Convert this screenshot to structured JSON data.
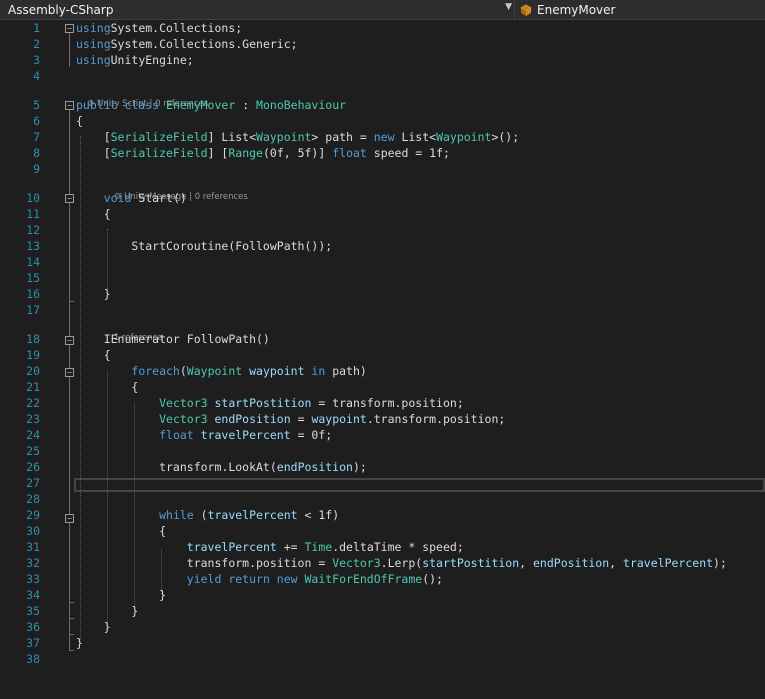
{
  "navbar": {
    "project": "Assembly-CSharp",
    "member": "EnemyMover",
    "member_icon": "class-member-icon"
  },
  "codelens": {
    "class_lens": "Unity Script | 0 references",
    "start_lens": "Unity Message | 0 references",
    "followpath_lens": "1 reference"
  },
  "line_numbers": [
    "1",
    "2",
    "3",
    "4",
    "5",
    "6",
    "7",
    "8",
    "9",
    "10",
    "11",
    "12",
    "13",
    "14",
    "15",
    "16",
    "17",
    "18",
    "19",
    "20",
    "21",
    "22",
    "23",
    "24",
    "25",
    "26",
    "27",
    "28",
    "29",
    "30",
    "31",
    "32",
    "33",
    "34",
    "35",
    "36",
    "37",
    "38"
  ],
  "lines": [
    [
      [
        "kw",
        "using"
      ],
      [
        "",
        "System.Collections;"
      ]
    ],
    [
      [
        "kw",
        "using"
      ],
      [
        "",
        "System.Collections.Generic;"
      ]
    ],
    [
      [
        "kw",
        "using"
      ],
      [
        "",
        "UnityEngine;"
      ]
    ],
    [],
    [
      [
        "kw",
        "public class "
      ],
      [
        "ty",
        "EnemyMover"
      ],
      [
        "",
        " : "
      ],
      [
        "ty",
        "MonoBehaviour"
      ]
    ],
    [
      [
        "",
        "{"
      ]
    ],
    [
      [
        "",
        "    ["
      ],
      [
        "ty",
        "SerializeField"
      ],
      [
        "",
        "] List<"
      ],
      [
        "ty",
        "Waypoint"
      ],
      [
        "",
        "> path = "
      ],
      [
        "kw",
        "new "
      ],
      [
        "",
        "List<"
      ],
      [
        "ty",
        "Waypoint"
      ],
      [
        "",
        ">();"
      ]
    ],
    [
      [
        "",
        "    ["
      ],
      [
        "ty",
        "SerializeField"
      ],
      [
        "",
        "] ["
      ],
      [
        "ty",
        "Range"
      ],
      [
        "",
        "(0f, 5f)] "
      ],
      [
        "kw",
        "float"
      ],
      [
        "",
        " speed = 1f;"
      ]
    ],
    [],
    [
      [
        "",
        "    "
      ],
      [
        "kw",
        "void "
      ],
      [
        "",
        "Start()"
      ]
    ],
    [
      [
        "",
        "    {"
      ]
    ],
    [],
    [
      [
        "",
        "        StartCoroutine(FollowPath());"
      ]
    ],
    [],
    [],
    [
      [
        "",
        "    }"
      ]
    ],
    [],
    [
      [
        "",
        "    IEnumerator FollowPath()"
      ]
    ],
    [
      [
        "",
        "    {"
      ]
    ],
    [
      [
        "",
        "        "
      ],
      [
        "kw",
        "foreach"
      ],
      [
        "",
        "("
      ],
      [
        "ty",
        "Waypoint"
      ],
      [
        " pm",
        " waypoint"
      ],
      [
        " kw",
        " in"
      ],
      [
        "",
        " path)"
      ]
    ],
    [
      [
        "",
        "        {"
      ]
    ],
    [
      [
        "",
        "            "
      ],
      [
        "ty",
        "Vector3"
      ],
      [
        "pm",
        " startPostition"
      ],
      [
        "",
        " = transform.position;"
      ]
    ],
    [
      [
        "",
        "            "
      ],
      [
        "ty",
        "Vector3"
      ],
      [
        "pm",
        " endPosition"
      ],
      [
        "",
        " = "
      ],
      [
        "pm",
        "waypoint"
      ],
      [
        "",
        ".transform.position;"
      ]
    ],
    [
      [
        "",
        "            "
      ],
      [
        "kw",
        "float"
      ],
      [
        "pm",
        " travelPercent"
      ],
      [
        "",
        " = 0f;"
      ]
    ],
    [],
    [
      [
        "",
        "            transform.LookAt("
      ],
      [
        "pm",
        "endPosition"
      ],
      [
        "",
        ");"
      ]
    ],
    [],
    [],
    [
      [
        "",
        "            "
      ],
      [
        "kw",
        "while"
      ],
      [
        "",
        " ("
      ],
      [
        "pm",
        "travelPercent"
      ],
      [
        "",
        " < 1f)"
      ]
    ],
    [
      [
        "",
        "            {"
      ]
    ],
    [
      [
        "",
        "                "
      ],
      [
        "pm",
        "travelPercent"
      ],
      [
        "",
        " += "
      ],
      [
        "ty",
        "Time"
      ],
      [
        "",
        ".deltaTime * speed;"
      ]
    ],
    [
      [
        "",
        "                transform.position = "
      ],
      [
        "ty",
        "Vector3"
      ],
      [
        "",
        ".Lerp("
      ],
      [
        "pm",
        "startPostition"
      ],
      [
        "",
        ", "
      ],
      [
        "pm",
        "endPosition"
      ],
      [
        "",
        ", "
      ],
      [
        "pm",
        "travelPercent"
      ],
      [
        "",
        ");"
      ]
    ],
    [
      [
        "",
        "                "
      ],
      [
        "kw",
        "yield return new "
      ],
      [
        "ty",
        "WaitForEndOfFrame"
      ],
      [
        "",
        "();"
      ]
    ],
    [
      [
        "",
        "            }"
      ]
    ],
    [
      [
        "",
        "        }"
      ]
    ],
    [
      [
        "",
        "    }"
      ]
    ],
    [
      [
        "",
        "}"
      ]
    ],
    []
  ]
}
